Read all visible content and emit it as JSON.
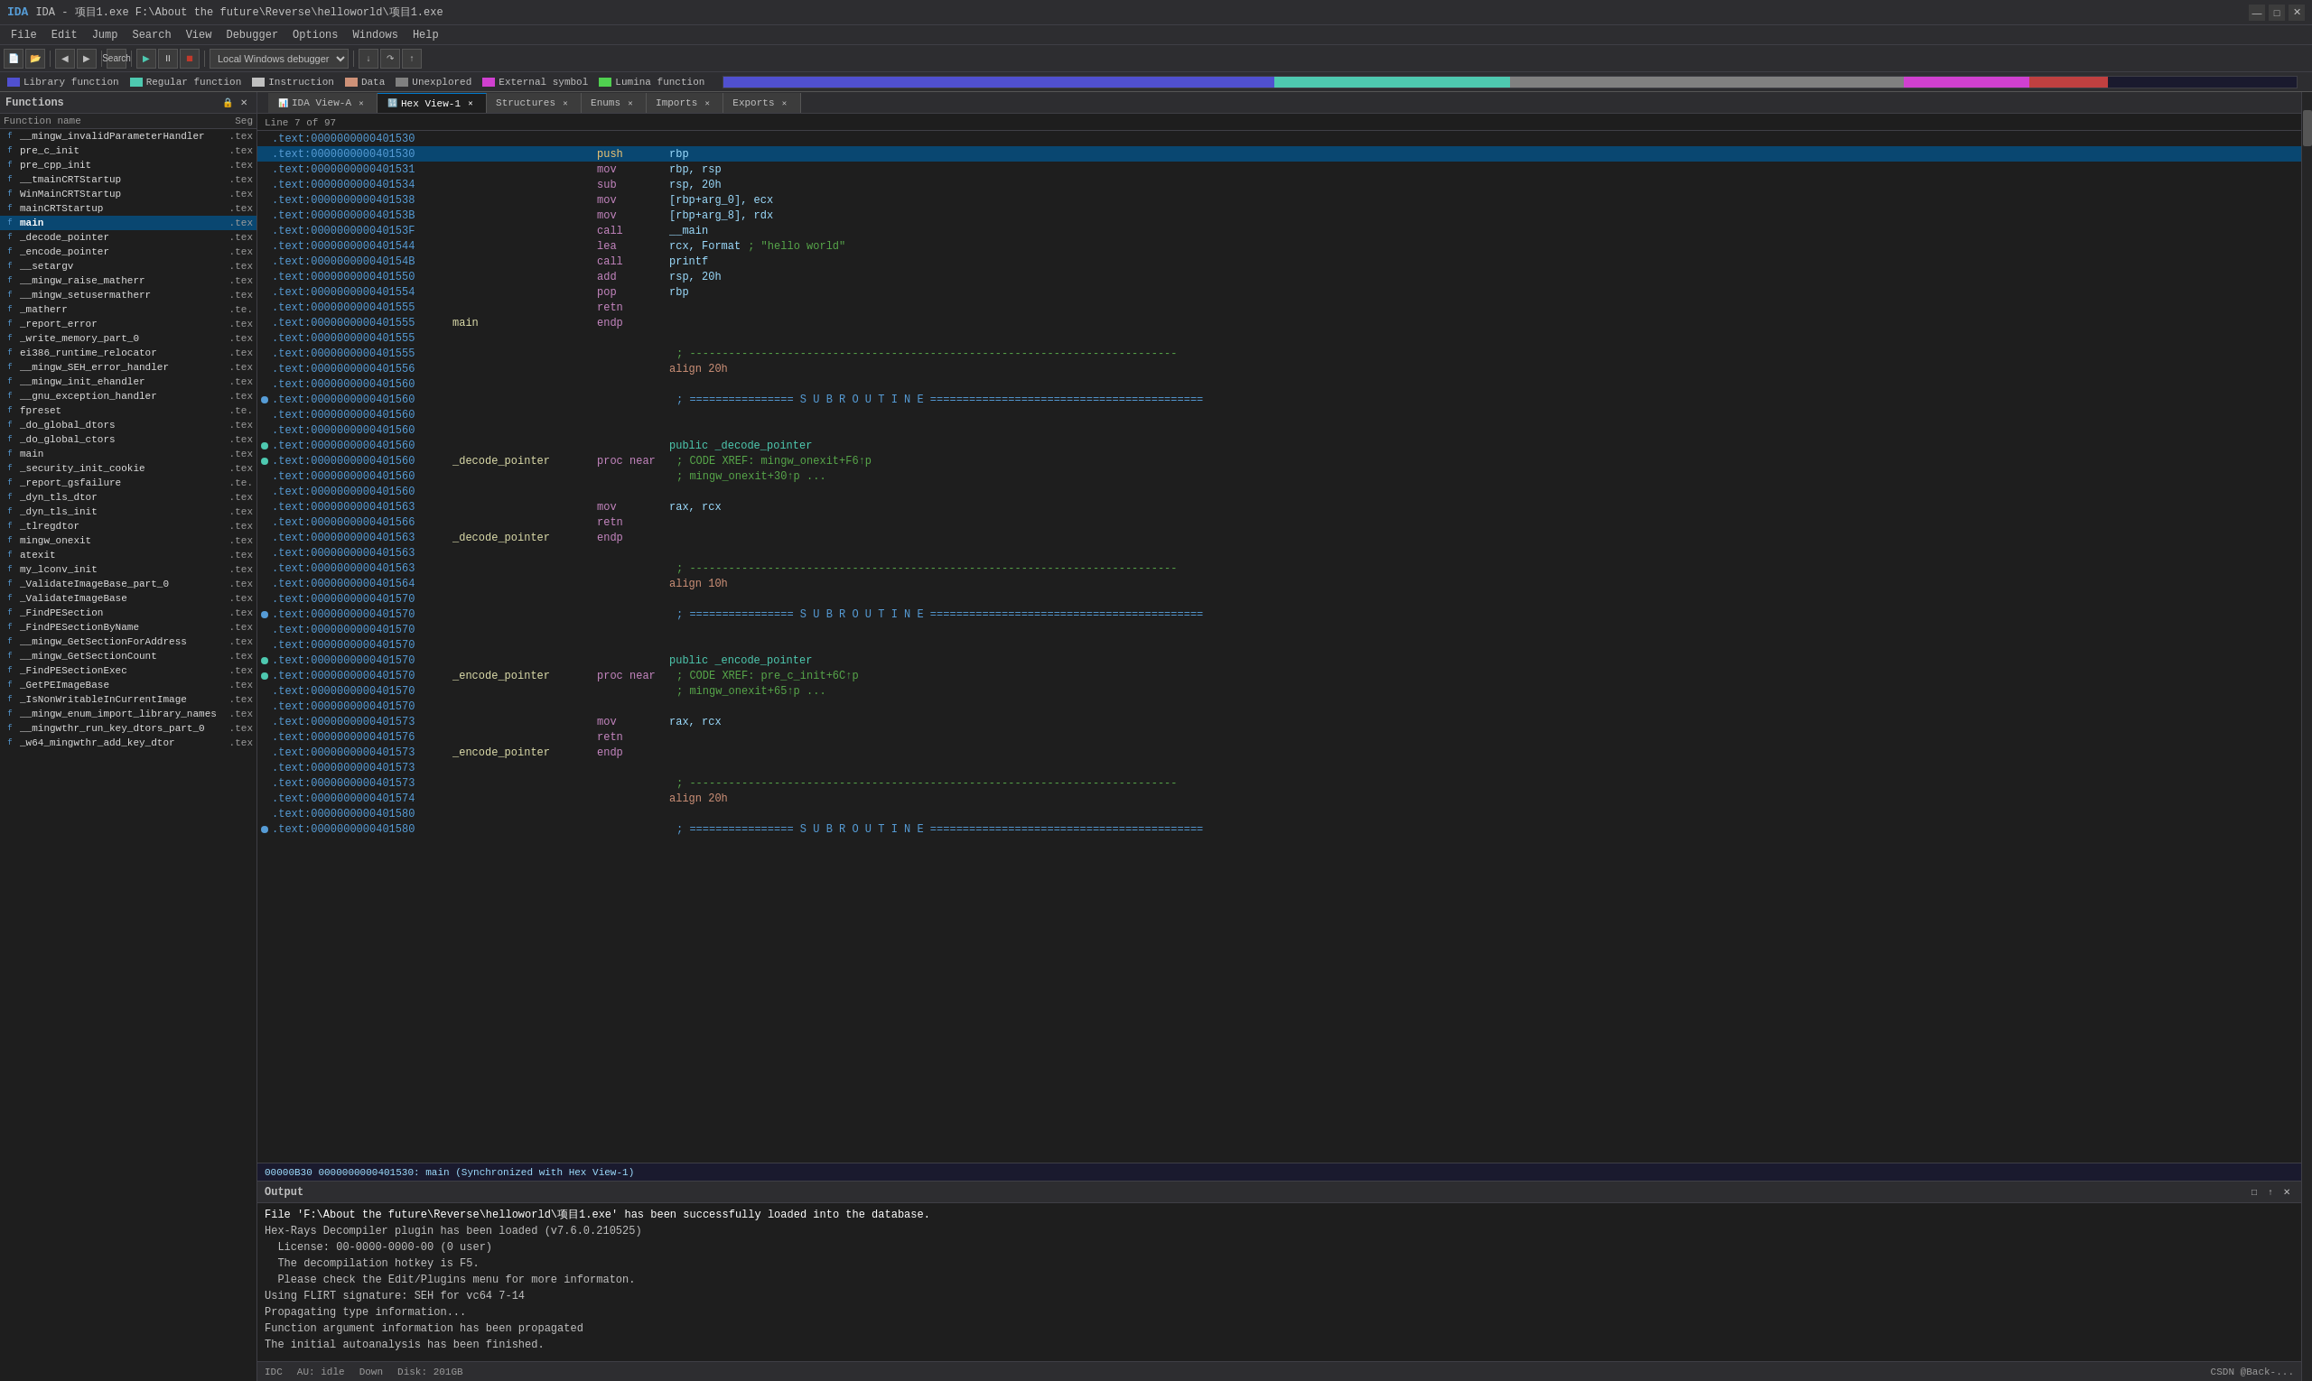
{
  "title_bar": {
    "title": "IDA - 项目1.exe F:\\About the future\\Reverse\\helloworld\\项目1.exe",
    "min_btn": "—",
    "max_btn": "□",
    "close_btn": "✕"
  },
  "menu": {
    "items": [
      "File",
      "Edit",
      "Jump",
      "Search",
      "View",
      "Debugger",
      "Options",
      "Windows",
      "Help"
    ]
  },
  "nav_legend": {
    "items": [
      {
        "label": "Library function",
        "color": "#5050d0"
      },
      {
        "label": "Regular function",
        "color": "#4ec9b0"
      },
      {
        "label": "Instruction",
        "color": "#c0c0c0"
      },
      {
        "label": "Data",
        "color": "#ce9178"
      },
      {
        "label": "Unexplored",
        "color": "#808080"
      },
      {
        "label": "External symbol",
        "color": "#d040d0"
      },
      {
        "label": "Lumina function",
        "color": "#50d050"
      }
    ]
  },
  "functions_panel": {
    "title": "Functions",
    "col_name": "Function name",
    "col_seg": "Seg",
    "functions": [
      {
        "name": "__mingw_invalidParameterHandler",
        "seg": ".tex",
        "selected": false
      },
      {
        "name": "pre_c_init",
        "seg": ".tex",
        "selected": false
      },
      {
        "name": "pre_cpp_init",
        "seg": ".tex",
        "selected": false
      },
      {
        "name": "__tmainCRTStartup",
        "seg": ".tex",
        "selected": false
      },
      {
        "name": "WinMainCRTStartup",
        "seg": ".tex",
        "selected": false
      },
      {
        "name": "mainCRTStartup",
        "seg": ".tex",
        "selected": false
      },
      {
        "name": "main",
        "seg": ".tex",
        "selected": true,
        "bold": true
      },
      {
        "name": "_decode_pointer",
        "seg": ".tex",
        "selected": false
      },
      {
        "name": "_encode_pointer",
        "seg": ".tex",
        "selected": false
      },
      {
        "name": "__setargv",
        "seg": ".tex",
        "selected": false
      },
      {
        "name": "__mingw_raise_matherr",
        "seg": ".tex",
        "selected": false
      },
      {
        "name": "__mingw_setusermatherr",
        "seg": ".tex",
        "selected": false
      },
      {
        "name": "_matherr",
        "seg": ".te.",
        "selected": false
      },
      {
        "name": "_report_error",
        "seg": ".tex",
        "selected": false
      },
      {
        "name": "_write_memory_part_0",
        "seg": ".tex",
        "selected": false
      },
      {
        "name": "ei386_runtime_relocator",
        "seg": ".tex",
        "selected": false
      },
      {
        "name": "__mingw_SEH_error_handler",
        "seg": ".tex",
        "selected": false
      },
      {
        "name": "__mingw_init_ehandler",
        "seg": ".tex",
        "selected": false
      },
      {
        "name": "__gnu_exception_handler",
        "seg": ".tex",
        "selected": false
      },
      {
        "name": "fpreset",
        "seg": ".te.",
        "selected": false
      },
      {
        "name": "_do_global_dtors",
        "seg": ".tex",
        "selected": false
      },
      {
        "name": "_do_global_ctors",
        "seg": ".tex",
        "selected": false
      },
      {
        "name": "main",
        "seg": ".tex",
        "selected": false
      },
      {
        "name": "_security_init_cookie",
        "seg": ".tex",
        "selected": false
      },
      {
        "name": "_report_gsfailure",
        "seg": ".te.",
        "selected": false
      },
      {
        "name": "_dyn_tls_dtor",
        "seg": ".tex",
        "selected": false
      },
      {
        "name": "_dyn_tls_init",
        "seg": ".tex",
        "selected": false
      },
      {
        "name": "_tlregdtor",
        "seg": ".tex",
        "selected": false
      },
      {
        "name": "mingw_onexit",
        "seg": ".tex",
        "selected": false
      },
      {
        "name": "atexit",
        "seg": ".tex",
        "selected": false
      },
      {
        "name": "my_lconv_init",
        "seg": ".tex",
        "selected": false
      },
      {
        "name": "_ValidateImageBase_part_0",
        "seg": ".tex",
        "selected": false
      },
      {
        "name": "_ValidateImageBase",
        "seg": ".tex",
        "selected": false
      },
      {
        "name": "_FindPESection",
        "seg": ".tex",
        "selected": false
      },
      {
        "name": "_FindPESectionByName",
        "seg": ".tex",
        "selected": false
      },
      {
        "name": "__mingw_GetSectionForAddress",
        "seg": ".tex",
        "selected": false
      },
      {
        "name": "__mingw_GetSectionCount",
        "seg": ".tex",
        "selected": false
      },
      {
        "name": "_FindPESectionExec",
        "seg": ".tex",
        "selected": false
      },
      {
        "name": "_GetPEImageBase",
        "seg": ".tex",
        "selected": false
      },
      {
        "name": "_IsNonWritableInCurrentImage",
        "seg": ".tex",
        "selected": false
      },
      {
        "name": "__mingw_enum_import_library_names",
        "seg": ".tex",
        "selected": false
      },
      {
        "name": "__mingwthr_run_key_dtors_part_0",
        "seg": ".tex",
        "selected": false
      },
      {
        "name": "_w64_mingwthr_add_key_dtor",
        "seg": ".tex",
        "selected": false
      }
    ]
  },
  "tabs": [
    {
      "label": "IDA View-A",
      "active": false
    },
    {
      "label": "Hex View-1",
      "active": true
    },
    {
      "label": "Structures",
      "active": false
    },
    {
      "label": "Enums",
      "active": false
    },
    {
      "label": "Imports",
      "active": false
    },
    {
      "label": "Exports",
      "active": false
    }
  ],
  "code_lines": [
    {
      "addr": ".text:0000000000401530",
      "label": "",
      "mnemonic": "",
      "operands": "",
      "comment": "",
      "type": "normal"
    },
    {
      "addr": ".text:0000000000401530",
      "label": "",
      "mnemonic": "push",
      "operands": "rbp",
      "comment": "",
      "type": "push"
    },
    {
      "addr": ".text:0000000000401531",
      "label": "",
      "mnemonic": "mov",
      "operands": "rbp, rsp",
      "comment": "",
      "type": "normal"
    },
    {
      "addr": ".text:0000000000401534",
      "label": "",
      "mnemonic": "sub",
      "operands": "rsp, 20h",
      "comment": "",
      "type": "normal"
    },
    {
      "addr": ".text:0000000000401538",
      "label": "",
      "mnemonic": "mov",
      "operands": "[rbp+arg_0], ecx",
      "comment": "",
      "type": "normal"
    },
    {
      "addr": ".text:000000000040153B",
      "label": "",
      "mnemonic": "mov",
      "operands": "[rbp+arg_8], rdx",
      "comment": "",
      "type": "normal"
    },
    {
      "addr": ".text:000000000040153F",
      "label": "",
      "mnemonic": "call",
      "operands": "__main",
      "comment": "",
      "type": "normal"
    },
    {
      "addr": ".text:0000000000401544",
      "label": "",
      "mnemonic": "lea",
      "operands": "rcx, Format",
      "comment": "; \"hello world\"",
      "type": "normal"
    },
    {
      "addr": ".text:000000000040154B",
      "label": "",
      "mnemonic": "call",
      "operands": "printf",
      "comment": "",
      "type": "normal"
    },
    {
      "addr": ".text:0000000000401550",
      "label": "",
      "mnemonic": "add",
      "operands": "rsp, 20h",
      "comment": "",
      "type": "normal"
    },
    {
      "addr": ".text:0000000000401554",
      "label": "",
      "mnemonic": "pop",
      "operands": "rbp",
      "comment": "",
      "type": "normal"
    },
    {
      "addr": ".text:0000000000401555",
      "label": "",
      "mnemonic": "retn",
      "operands": "",
      "comment": "",
      "type": "normal"
    },
    {
      "addr": ".text:0000000000401555",
      "label": "main",
      "mnemonic": "endp",
      "operands": "",
      "comment": "",
      "type": "endp"
    },
    {
      "addr": ".text:0000000000401555",
      "label": "",
      "mnemonic": "",
      "operands": "",
      "comment": "",
      "type": "normal"
    },
    {
      "addr": ".text:0000000000401555",
      "label": "",
      "mnemonic": "",
      "operands": "",
      "comment": "; ---------------------------------------------------------------------------",
      "type": "sep"
    },
    {
      "addr": ".text:0000000000401556",
      "label": "",
      "mnemonic": "",
      "operands": "align 20h",
      "comment": "",
      "type": "align"
    },
    {
      "addr": ".text:0000000000401560",
      "label": "",
      "mnemonic": "",
      "operands": "",
      "comment": "",
      "type": "normal"
    },
    {
      "addr": ".text:0000000000401560",
      "label": "",
      "mnemonic": "",
      "operands": "",
      "comment": "; ================ S U B R O U T I N E ==========================================",
      "type": "subroutine"
    },
    {
      "addr": ".text:0000000000401560",
      "label": "",
      "mnemonic": "",
      "operands": "",
      "comment": "",
      "type": "normal"
    },
    {
      "addr": ".text:0000000000401560",
      "label": "",
      "mnemonic": "",
      "operands": "",
      "comment": "",
      "type": "normal"
    },
    {
      "addr": ".text:0000000000401560",
      "label": "",
      "mnemonic": "",
      "operands": "public _decode_pointer",
      "comment": "",
      "type": "public"
    },
    {
      "addr": ".text:0000000000401560",
      "label": "_decode_pointer",
      "mnemonic": "proc near",
      "operands": "",
      "comment": "; CODE XREF: mingw_onexit+F6↑p",
      "type": "proc"
    },
    {
      "addr": ".text:0000000000401560",
      "label": "",
      "mnemonic": "",
      "operands": "",
      "comment": ";                 mingw_onexit+30↑p ...",
      "type": "comment_only"
    },
    {
      "addr": ".text:0000000000401560",
      "label": "",
      "mnemonic": "",
      "operands": "",
      "comment": "",
      "type": "normal"
    },
    {
      "addr": ".text:0000000000401563",
      "label": "",
      "mnemonic": "mov",
      "operands": "rax, rcx",
      "comment": "",
      "type": "normal"
    },
    {
      "addr": ".text:0000000000401566",
      "label": "",
      "mnemonic": "retn",
      "operands": "",
      "comment": "",
      "type": "normal"
    },
    {
      "addr": ".text:0000000000401563",
      "label": "_decode_pointer",
      "mnemonic": "endp",
      "operands": "",
      "comment": "",
      "type": "endp"
    },
    {
      "addr": ".text:0000000000401563",
      "label": "",
      "mnemonic": "",
      "operands": "",
      "comment": "",
      "type": "normal"
    },
    {
      "addr": ".text:0000000000401563",
      "label": "",
      "mnemonic": "",
      "operands": "",
      "comment": "; ---------------------------------------------------------------------------",
      "type": "sep"
    },
    {
      "addr": ".text:0000000000401564",
      "label": "",
      "mnemonic": "",
      "operands": "align 10h",
      "comment": "",
      "type": "align"
    },
    {
      "addr": ".text:0000000000401570",
      "label": "",
      "mnemonic": "",
      "operands": "",
      "comment": "",
      "type": "normal"
    },
    {
      "addr": ".text:0000000000401570",
      "label": "",
      "mnemonic": "",
      "operands": "",
      "comment": "; ================ S U B R O U T I N E ==========================================",
      "type": "subroutine"
    },
    {
      "addr": ".text:0000000000401570",
      "label": "",
      "mnemonic": "",
      "operands": "",
      "comment": "",
      "type": "normal"
    },
    {
      "addr": ".text:0000000000401570",
      "label": "",
      "mnemonic": "",
      "operands": "",
      "comment": "",
      "type": "normal"
    },
    {
      "addr": ".text:0000000000401570",
      "label": "",
      "mnemonic": "",
      "operands": "public _encode_pointer",
      "comment": "",
      "type": "public"
    },
    {
      "addr": ".text:0000000000401570",
      "label": "_encode_pointer",
      "mnemonic": "proc near",
      "operands": "",
      "comment": "; CODE XREF: pre_c_init+6C↑p",
      "type": "proc"
    },
    {
      "addr": ".text:0000000000401570",
      "label": "",
      "mnemonic": "",
      "operands": "",
      "comment": ";                 mingw_onexit+65↑p ...",
      "type": "comment_only"
    },
    {
      "addr": ".text:0000000000401570",
      "label": "",
      "mnemonic": "",
      "operands": "",
      "comment": "",
      "type": "normal"
    },
    {
      "addr": ".text:0000000000401573",
      "label": "",
      "mnemonic": "mov",
      "operands": "rax, rcx",
      "comment": "",
      "type": "normal"
    },
    {
      "addr": ".text:0000000000401576",
      "label": "",
      "mnemonic": "retn",
      "operands": "",
      "comment": "",
      "type": "normal"
    },
    {
      "addr": ".text:0000000000401573",
      "label": "_encode_pointer",
      "mnemonic": "endp",
      "operands": "",
      "comment": "",
      "type": "endp"
    },
    {
      "addr": ".text:0000000000401573",
      "label": "",
      "mnemonic": "",
      "operands": "",
      "comment": "",
      "type": "normal"
    },
    {
      "addr": ".text:0000000000401573",
      "label": "",
      "mnemonic": "",
      "operands": "",
      "comment": "; ---------------------------------------------------------------------------",
      "type": "sep"
    },
    {
      "addr": ".text:0000000000401574",
      "label": "",
      "mnemonic": "",
      "operands": "align 20h",
      "comment": "",
      "type": "align"
    },
    {
      "addr": ".text:0000000000401580",
      "label": "",
      "mnemonic": "",
      "operands": "",
      "comment": "",
      "type": "normal"
    },
    {
      "addr": ".text:0000000000401580",
      "label": "",
      "mnemonic": "",
      "operands": "",
      "comment": "; ================ S U B R O U T I N E ==========================================",
      "type": "subroutine"
    }
  ],
  "status_line": "Line 7 of 97",
  "address_bar": "00000B30  0000000000401530: main (Synchronized with Hex View-1)",
  "output": {
    "title": "Output",
    "lines": [
      "File 'F:\\About the future\\Reverse\\helloworld\\项目1.exe' has been successfully loaded into the database.",
      "Hex-Rays Decompiler plugin has been loaded (v7.6.0.210525)",
      "  License: 00-0000-0000-00 (0 user)",
      "  The decompilation hotkey is F5.",
      "  Please check the Edit/Plugins menu for more informaton.",
      "Using FLIRT signature: SEH for vc64 7-14",
      "Propagating type information...",
      "Function argument information has been propagated",
      "The initial autoanalysis has been finished."
    ]
  },
  "bottom_status": {
    "idc": "IDC",
    "au": "AU: idle",
    "down": "Down",
    "disk": "Disk: 201GB"
  },
  "watermark": "CSDN @Back-..."
}
